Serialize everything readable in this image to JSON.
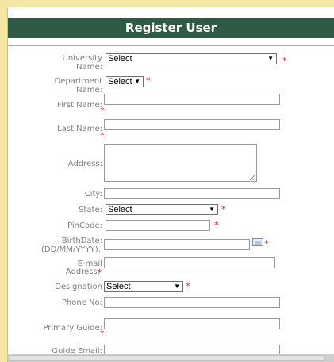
{
  "header": {
    "title": "Register User"
  },
  "form": {
    "university": {
      "label": "University Name:",
      "value": "Select"
    },
    "department": {
      "label": "Department Name:",
      "value": "Select"
    },
    "first_name": {
      "label": "First Name:",
      "value": ""
    },
    "last_name": {
      "label": "Last Name:",
      "value": ""
    },
    "address": {
      "label": "Address:",
      "value": ""
    },
    "city": {
      "label": "City:",
      "value": ""
    },
    "state": {
      "label": "State:",
      "value": "Select"
    },
    "pincode": {
      "label": "PinCode:",
      "value": ""
    },
    "birthdate": {
      "label": "BirthDate:",
      "label2": "(DD/MM/YYYY):",
      "value": ""
    },
    "email": {
      "label": "E-mail",
      "label2": "Address:",
      "value": ""
    },
    "designation": {
      "label": "Designation",
      "value": "Select"
    },
    "phone": {
      "label": "Phone No:",
      "value": ""
    },
    "primary_guide": {
      "label": "Primary Guide:",
      "value": ""
    },
    "guide_email": {
      "label": "Guide Email:",
      "value": ""
    }
  },
  "required_mark": "*",
  "dropdown_arrow": "▼",
  "icons": {
    "calendar": "calendar-icon",
    "resize": "resize-grip-icon"
  },
  "colors": {
    "background": "#f5e6a3",
    "titlebar": "#2f5a44",
    "accent_line": "#f0a030",
    "required": "#e02020",
    "label": "#7d7d7d"
  }
}
